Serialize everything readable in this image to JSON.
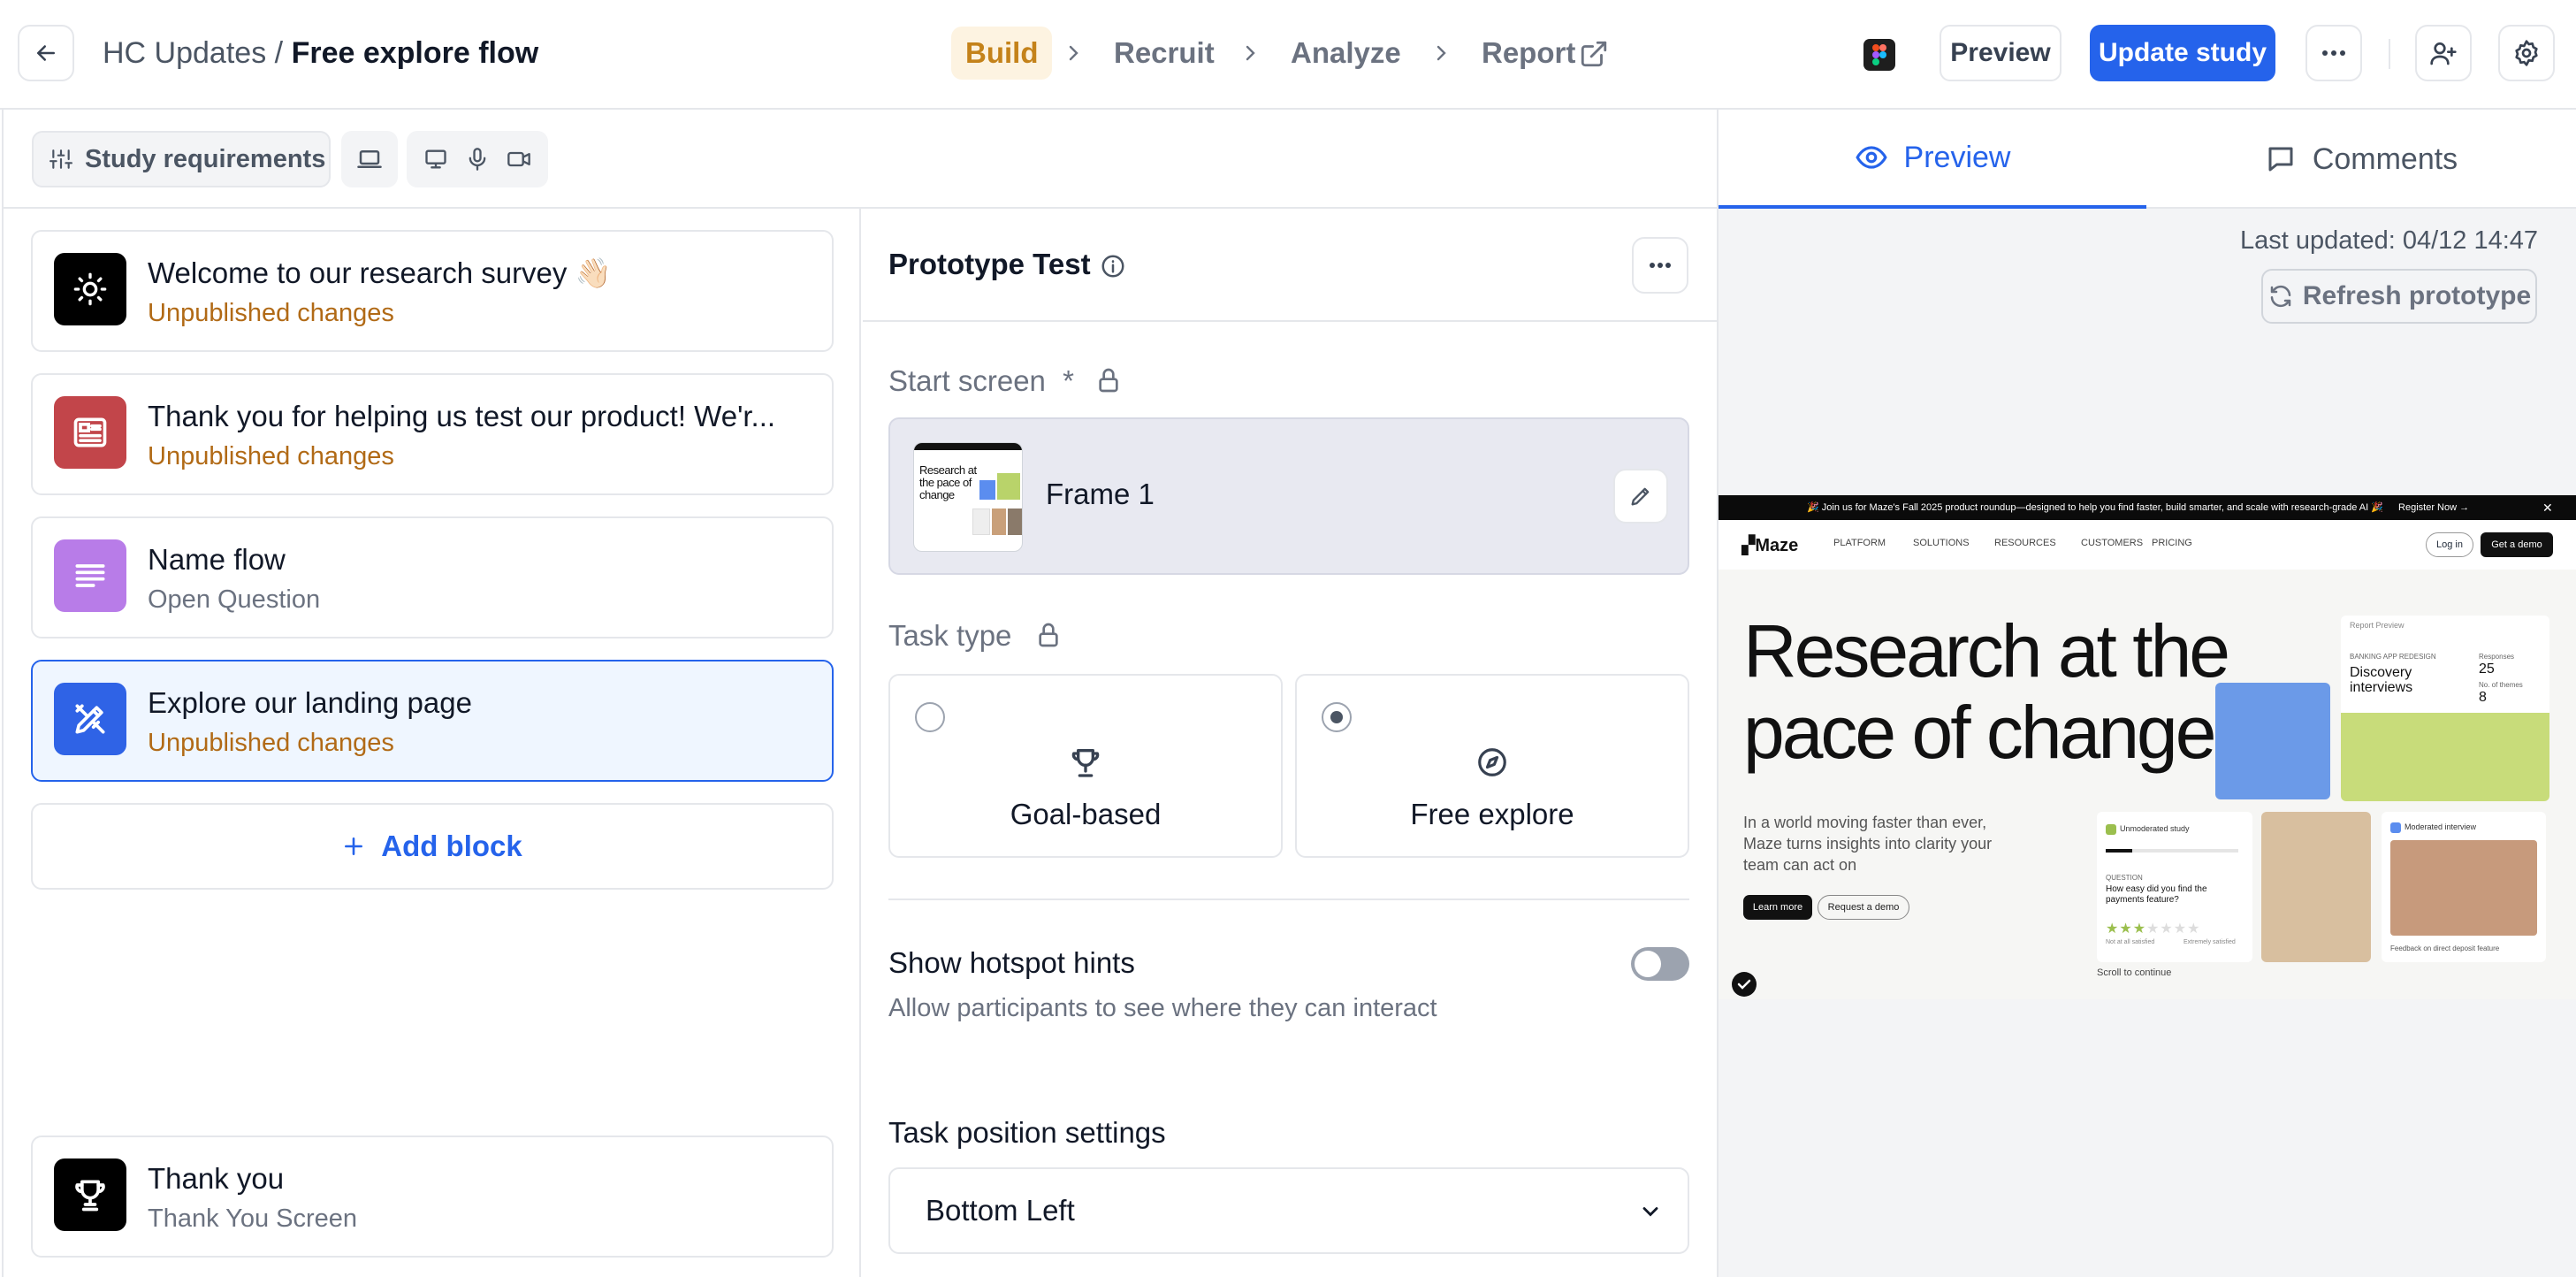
{
  "breadcrumb": {
    "project": "HC Updates",
    "separator": "/",
    "study": "Free explore flow"
  },
  "steps": [
    {
      "label": "Build",
      "active": true
    },
    {
      "label": "Recruit"
    },
    {
      "label": "Analyze"
    },
    {
      "label": "Report"
    }
  ],
  "header": {
    "preview_label": "Preview",
    "update_label": "Update study"
  },
  "requirements": {
    "label": "Study requirements"
  },
  "blocks": [
    {
      "title": "Welcome to our research survey 👋🏻",
      "subtitle": "Unpublished changes",
      "icon": "sun-icon"
    },
    {
      "title": "Thank you for helping us test our product! We'r...",
      "subtitle": "Unpublished changes",
      "icon": "form-icon"
    },
    {
      "title": "Name flow",
      "subtitle": "Open Question",
      "icon": "text-lines-icon"
    },
    {
      "title": "Explore our landing page",
      "subtitle": "Unpublished changes",
      "icon": "prototype-icon"
    }
  ],
  "add_block_label": "Add block",
  "final_block": {
    "title": "Thank you",
    "subtitle": "Thank You Screen",
    "icon": "trophy-icon"
  },
  "editor": {
    "title": "Prototype Test",
    "start_screen_label": "Start screen",
    "required_mark": "*",
    "frame_name": "Frame 1",
    "frame_thumb_text": "Research at the pace of change",
    "task_type_label": "Task type",
    "task_types": [
      {
        "label": "Goal-based",
        "selected": false
      },
      {
        "label": "Free explore",
        "selected": true
      }
    ],
    "hotspot": {
      "title": "Show hotspot hints",
      "description": "Allow participants to see where they can interact",
      "enabled": false
    },
    "task_position": {
      "label": "Task position settings",
      "value": "Bottom Left"
    }
  },
  "right_panel": {
    "tabs": [
      {
        "label": "Preview",
        "active": true
      },
      {
        "label": "Comments"
      }
    ],
    "last_updated": "Last updated: 04/12 14:47",
    "refresh_label": "Refresh prototype"
  },
  "prototype_page": {
    "banner": "🎉 Join us for Maze's Fall 2025 product roundup—designed to help you find faster, build smarter, and scale with research-grade AI 🎉",
    "banner_cta": "Register Now →",
    "logo": "Maze",
    "nav": [
      "PLATFORM",
      "SOLUTIONS",
      "RESOURCES",
      "CUSTOMERS",
      "PRICING"
    ],
    "login": "Log in",
    "demo": "Get a demo",
    "headline_1": "Research at the",
    "headline_2": "pace of change",
    "copy": "In a world moving faster than ever, Maze turns insights into clarity your team can act on",
    "learn_more": "Learn more",
    "request_demo": "Request a demo",
    "report_card": {
      "label": "Report Preview",
      "kicker": "BANKING APP REDESIGN",
      "title": "Discovery interviews",
      "responses_label": "Responses",
      "responses": "25",
      "themes_label": "No. of themes",
      "themes": "8"
    },
    "study_card": {
      "label": "Unmoderated study",
      "question_kicker": "QUESTION",
      "question": "How easy did you find the payments feature?",
      "scale_low": "Not at all satisfied",
      "scale_high": "Extremely satisfied"
    },
    "interview_card": {
      "label": "Moderated interview",
      "caption": "Feedback on direct deposit feature"
    },
    "scroll": "Scroll to continue"
  }
}
